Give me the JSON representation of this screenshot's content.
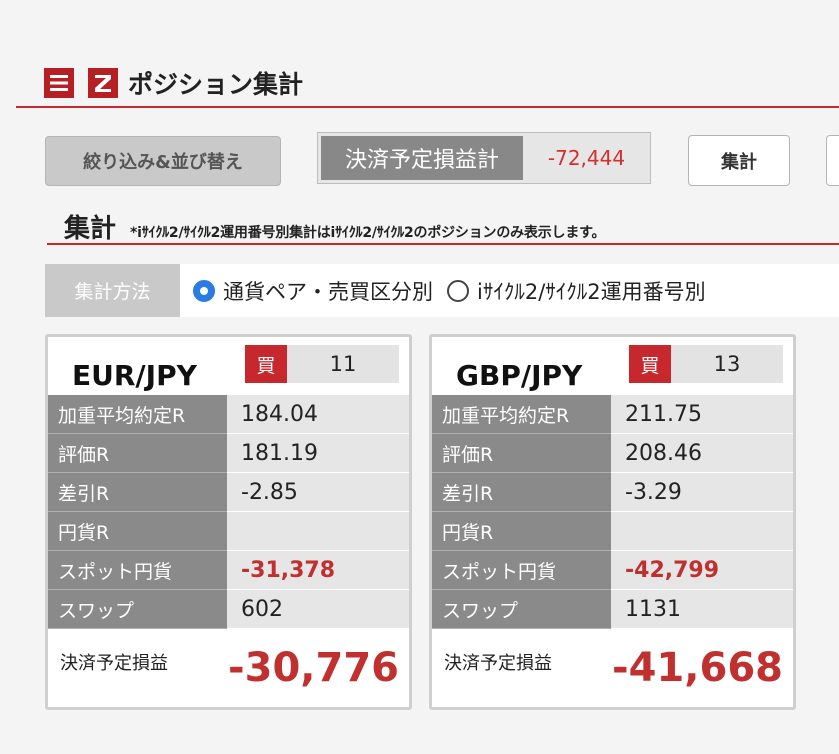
{
  "header": {
    "menu_icon": "menu-icon",
    "z_icon": "z-logo-icon",
    "title": "ポジション集計"
  },
  "toolbar": {
    "filter_label": "絞り込み&並び替え",
    "pl_label": "決済予定損益計",
    "pl_value": "-72,444",
    "sum_label": "集計"
  },
  "section": {
    "title": "集計",
    "note": "*iｻｲｸﾙ2/ｻｲｸﾙ2運用番号別集計はiｻｲｸﾙ2/ｻｲｸﾙ2のポジションのみ表示します。"
  },
  "method": {
    "label": "集計方法",
    "options": [
      {
        "label": "通貨ペア・売買区分別",
        "selected": true
      },
      {
        "label": "iｻｲｸﾙ2/ｻｲｸﾙ2運用番号別",
        "selected": false
      }
    ]
  },
  "cards": [
    {
      "pair": "EUR/JPY",
      "side": "買",
      "qty": "11",
      "rows": [
        {
          "k": "加重平均約定R",
          "v": "184.04"
        },
        {
          "k": "評価R",
          "v": "181.19"
        },
        {
          "k": "差引R",
          "v": "-2.85"
        },
        {
          "k": "円貨R",
          "v": ""
        },
        {
          "k": "スポット円貨",
          "v": "-31,378"
        },
        {
          "k": "スワップ",
          "v": "602"
        }
      ],
      "foot_label": "決済予定損益",
      "foot_value": "-30,776"
    },
    {
      "pair": "GBP/JPY",
      "side": "買",
      "qty": "13",
      "rows": [
        {
          "k": "加重平均約定R",
          "v": "211.75"
        },
        {
          "k": "評価R",
          "v": "208.46"
        },
        {
          "k": "差引R",
          "v": "-3.29"
        },
        {
          "k": "円貨R",
          "v": ""
        },
        {
          "k": "スポット円貨",
          "v": "-42,799"
        },
        {
          "k": "スワップ",
          "v": "1131"
        }
      ],
      "foot_label": "決済予定損益",
      "foot_value": "-41,668"
    }
  ],
  "colors": {
    "accent_red": "#c62a2f",
    "negative": "#c0302f",
    "radio_blue": "#2a7be4"
  }
}
